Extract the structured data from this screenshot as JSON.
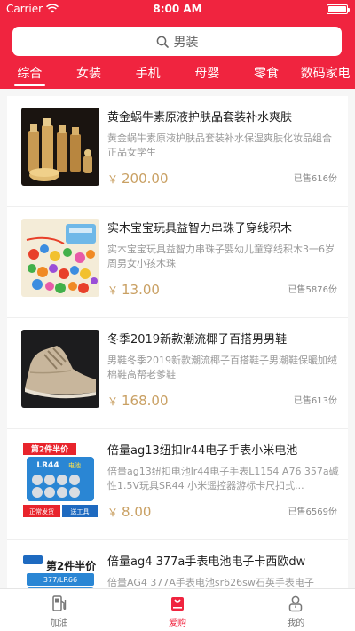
{
  "status_bar": {
    "carrier": "Carrier",
    "time": "8:00 AM",
    "battery_level": 1.0
  },
  "search": {
    "text": "男装"
  },
  "tabs": [
    {
      "label": "综合",
      "active": true
    },
    {
      "label": "女装",
      "active": false
    },
    {
      "label": "手机",
      "active": false
    },
    {
      "label": "母婴",
      "active": false
    },
    {
      "label": "零食",
      "active": false
    },
    {
      "label": "数码家电",
      "active": false
    }
  ],
  "products": [
    {
      "title": "黄金蜗牛素原液护肤品套装补水爽肤",
      "desc": "黄金蜗牛素原液护肤品套装补水保湿爽肤化妆品组合正品女学生",
      "currency": "￥",
      "price": "200.00",
      "sold": "已售616份",
      "image": "skincare-set-image"
    },
    {
      "title": "实木宝宝玩具益智力串珠子穿线积木",
      "desc": "实木宝宝玩具益智力串珠子婴幼儿童穿线积木3一6岁周男女小孩木珠",
      "currency": "￥",
      "price": "13.00",
      "sold": "已售5876份",
      "image": "bead-toy-image"
    },
    {
      "title": "冬季2019新款潮流椰子百搭男男鞋",
      "desc": "男鞋冬季2019新款潮流椰子百搭鞋子男潮鞋保暖加绒棉鞋高帮老爹鞋",
      "currency": "￥",
      "price": "168.00",
      "sold": "已售613份",
      "image": "sneaker-image"
    },
    {
      "title": "倍量ag13纽扣lr44电子手表小米电池",
      "desc": "倍量ag13纽扣电池lr44电子手表L1154 A76 357a碱性1.5V玩具SR44 小米遥控器游标卡尺扣式...",
      "currency": "￥",
      "price": "8.00",
      "sold": "已售6569份",
      "image": "battery-pack-image",
      "img_text": {
        "banner": "第2件半价",
        "model": "LR44",
        "model_suffix": "电池",
        "left": "正常发货",
        "right": "送工具"
      }
    },
    {
      "title": "倍量ag4 377a手表电池电子卡西欧dw",
      "desc": "倍量AG4 377A手表电池sr626sw石英手表电子",
      "currency": "￥",
      "price": "",
      "sold": "",
      "image": "watch-battery-image",
      "img_text": {
        "banner": "第2件半价",
        "model": "377/LR66"
      }
    }
  ],
  "bottom_nav": [
    {
      "label": "加油",
      "icon": "fuel-pump-icon",
      "active": false
    },
    {
      "label": "爱购",
      "icon": "shopping-bag-icon",
      "active": true
    },
    {
      "label": "我的",
      "icon": "person-icon",
      "active": false
    }
  ],
  "colors": {
    "brand": "#f0243f",
    "price": "#c9a063"
  }
}
